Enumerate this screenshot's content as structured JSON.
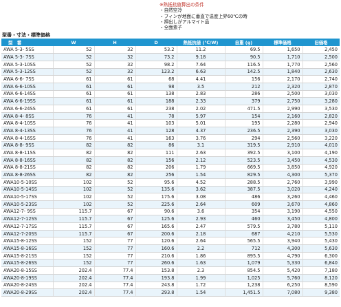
{
  "notes": {
    "heading": "※熱抵抗値算出の条件",
    "conditions": [
      "・自然空冷",
      "・フィンが地面に垂直で温度上昇60℃の時",
      "・押出しがアルマイト品",
      "・全面素子"
    ]
  },
  "section_title": "型番・寸法・標準価格",
  "table": {
    "headers": [
      "型　番",
      "W",
      "H",
      "D",
      "熱抵抗値 (℃/W)",
      "自重 (g)",
      "標準価格",
      "旧価格"
    ],
    "rows": [
      [
        "AWA  5-3-  5SS",
        "52",
        "32",
        "53.2",
        "11.2",
        "69.5",
        "1,650",
        "2,450"
      ],
      [
        "AWA  5-3-  7SS",
        "52",
        "32",
        "73.2",
        "9.18",
        "90.5",
        "1,710",
        "2,500"
      ],
      [
        "AWA  5-3-10SS",
        "52",
        "32",
        "98.2",
        "7.64",
        "116.5",
        "1,770",
        "2,560"
      ],
      [
        "AWA  5-3-12SS",
        "52",
        "32",
        "123.2",
        "6.63",
        "142.5",
        "1,840",
        "2,630"
      ],
      [
        "AWA  6-6-  7SS",
        "61",
        "61",
        "68",
        "4.41",
        "156",
        "2,170",
        "2,740"
      ],
      [
        "AWA  6-6-10SS",
        "61",
        "61",
        "98",
        "3.5",
        "212",
        "2,320",
        "2,870"
      ],
      [
        "AWA  6-6-14SS",
        "61",
        "61",
        "138",
        "2.83",
        "286",
        "2,500",
        "3,030"
      ],
      [
        "AWA  6-6-19SS",
        "61",
        "61",
        "188",
        "2.33",
        "379",
        "2,750",
        "3,280"
      ],
      [
        "AWA  6-6-24SS",
        "61",
        "61",
        "238",
        "2.02",
        "471.5",
        "2,990",
        "3,530"
      ],
      [
        "AWA  8-4-  8SS",
        "76",
        "41",
        "78",
        "5.97",
        "154",
        "2,160",
        "2,820"
      ],
      [
        "AWA  8-4-10SS",
        "76",
        "41",
        "103",
        "5.01",
        "195",
        "2,280",
        "2,940"
      ],
      [
        "AWA  8-4-13SS",
        "76",
        "41",
        "128",
        "4.37",
        "236.5",
        "2,390",
        "3,030"
      ],
      [
        "AWA  8-4-16SS",
        "76",
        "41",
        "163",
        "3.76",
        "294",
        "2,560",
        "3,220"
      ],
      [
        "AWA  8-8-  9SS",
        "82",
        "82",
        "86",
        "3.1",
        "319.5",
        "2,910",
        "4,010"
      ],
      [
        "AWA  8-8-11SS",
        "82",
        "82",
        "111",
        "2.63",
        "392.5",
        "3,100",
        "4,190"
      ],
      [
        "AWA  8-8-16SS",
        "82",
        "82",
        "156",
        "2.12",
        "523.5",
        "3,450",
        "4,530"
      ],
      [
        "AWA  8-8-21SS",
        "82",
        "82",
        "206",
        "1.79",
        "669.5",
        "3,850",
        "4,920"
      ],
      [
        "AWA  8-8-26SS",
        "82",
        "82",
        "256",
        "1.54",
        "829.5",
        "4,300",
        "5,370"
      ],
      [
        "AWA10-5-10SS",
        "102",
        "52",
        "95.6",
        "4.52",
        "288.5",
        "2,760",
        "3,990"
      ],
      [
        "AWA10-5-14SS",
        "102",
        "52",
        "135.6",
        "3.62",
        "387.5",
        "3,020",
        "4,240"
      ],
      [
        "AWA10-5-17SS",
        "102",
        "52",
        "175.6",
        "3.08",
        "486",
        "3,260",
        "4,460"
      ],
      [
        "AWA10-5-23SS",
        "102",
        "52",
        "225.6",
        "2.64",
        "609",
        "3,670",
        "4,860"
      ],
      [
        "AWA12-7-  9SS",
        "115.7",
        "67",
        "90.6",
        "3.6",
        "354",
        "3,190",
        "4,550"
      ],
      [
        "AWA12-7-12SS",
        "115.7",
        "67",
        "125.6",
        "2.93",
        "460",
        "3,450",
        "4,800"
      ],
      [
        "AWA12-7-17SS",
        "115.7",
        "67",
        "165.6",
        "2.47",
        "579.5",
        "3,780",
        "5,110"
      ],
      [
        "AWA12-7-20SS",
        "115.7",
        "67",
        "200.6",
        "2.18",
        "687",
        "4,210",
        "5,530"
      ],
      [
        "AWA15-8-12SS",
        "152",
        "77",
        "120.6",
        "2.64",
        "565.5",
        "3,940",
        "5,430"
      ],
      [
        "AWA15-8-16SS",
        "152",
        "77",
        "160.6",
        "2.2",
        "712",
        "4,300",
        "5,630"
      ],
      [
        "AWA15-8-21SS",
        "152",
        "77",
        "210.6",
        "1.86",
        "895.5",
        "4,790",
        "6,300"
      ],
      [
        "AWA15-8-26SS",
        "152",
        "77",
        "260.6",
        "1.63",
        "1,079",
        "5,330",
        "6,840"
      ],
      [
        "AWA20-8-15SS",
        "202.4",
        "77.4",
        "153.8",
        "2.3",
        "854.5",
        "5,420",
        "7,180"
      ],
      [
        "AWA20-8-19SS",
        "202.4",
        "77.4",
        "193.8",
        "1.99",
        "1,025",
        "5,760",
        "8,120"
      ],
      [
        "AWA20-8-24SS",
        "202.4",
        "77.4",
        "243.8",
        "1.72",
        "1,238",
        "6,250",
        "8,590"
      ],
      [
        "AWA20-8-29SS",
        "202.4",
        "77.4",
        "293.8",
        "1.54",
        "1,451.5",
        "7,080",
        "9,380"
      ]
    ]
  }
}
